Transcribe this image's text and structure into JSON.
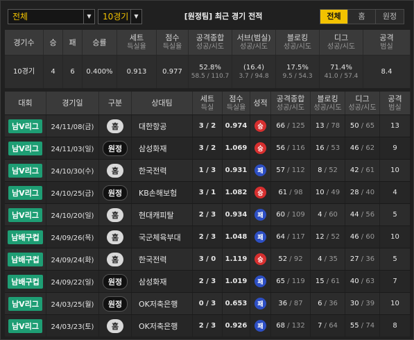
{
  "controls": {
    "filter_value": "전체",
    "games_value": "10경기",
    "title": "[원정팀] 최근 경기 전적",
    "segments": [
      {
        "label": "전체",
        "active": true
      },
      {
        "label": "홈",
        "active": false
      },
      {
        "label": "원정",
        "active": false
      }
    ]
  },
  "summary": {
    "headers": [
      {
        "main": "경기수",
        "sub": ""
      },
      {
        "main": "승",
        "sub": ""
      },
      {
        "main": "패",
        "sub": ""
      },
      {
        "main": "승률",
        "sub": ""
      },
      {
        "main": "세트",
        "sub": "득실율"
      },
      {
        "main": "점수",
        "sub": "득실율"
      },
      {
        "main": "공격종합",
        "sub": "성공/시도"
      },
      {
        "main": "서브(범실)",
        "sub": "성공/시도"
      },
      {
        "main": "블로킹",
        "sub": "성공/시도"
      },
      {
        "main": "디그",
        "sub": "성공/시도"
      },
      {
        "main": "공격",
        "sub": "범실"
      }
    ],
    "values": [
      {
        "main": "10경기",
        "sub": ""
      },
      {
        "main": "4",
        "sub": ""
      },
      {
        "main": "6",
        "sub": ""
      },
      {
        "main": "0.400%",
        "sub": ""
      },
      {
        "main": "0.913",
        "sub": ""
      },
      {
        "main": "0.977",
        "sub": ""
      },
      {
        "main": "52.8%",
        "sub": "58.5 / 110.7"
      },
      {
        "main": "(16.4)",
        "sub": "3.7 / 94.8"
      },
      {
        "main": "17.5%",
        "sub": "9.5 / 54.3"
      },
      {
        "main": "71.4%",
        "sub": "41.0 / 57.4"
      },
      {
        "main": "8.4",
        "sub": ""
      }
    ]
  },
  "table": {
    "headers": [
      {
        "main": "대회",
        "sub": ""
      },
      {
        "main": "경기일",
        "sub": ""
      },
      {
        "main": "구분",
        "sub": ""
      },
      {
        "main": "상대팀",
        "sub": ""
      },
      {
        "main": "세트",
        "sub": "득실"
      },
      {
        "main": "점수",
        "sub": "득실율"
      },
      {
        "main": "성적",
        "sub": ""
      },
      {
        "main": "공격종합",
        "sub": "성공/시도"
      },
      {
        "main": "블로킹",
        "sub": "성공/시도"
      },
      {
        "main": "디그",
        "sub": "성공/시도"
      },
      {
        "main": "공격",
        "sub": "범실"
      }
    ],
    "rows": [
      {
        "league": "남V리그",
        "date": "24/11/08(금)",
        "venue": "홈",
        "venue_type": "home",
        "opponent": "대한항공",
        "sets": "3 / 2",
        "pts": "0.974",
        "result": "승",
        "result_type": "win",
        "atk_a": "66",
        "atk_b": "125",
        "blk_a": "13",
        "blk_b": "78",
        "dig_a": "50",
        "dig_b": "65",
        "err": "13"
      },
      {
        "league": "남V리그",
        "date": "24/11/03(일)",
        "venue": "원정",
        "venue_type": "away",
        "opponent": "삼성화재",
        "sets": "3 / 2",
        "pts": "1.069",
        "result": "승",
        "result_type": "win",
        "atk_a": "56",
        "atk_b": "116",
        "blk_a": "16",
        "blk_b": "53",
        "dig_a": "46",
        "dig_b": "62",
        "err": "9"
      },
      {
        "league": "남V리그",
        "date": "24/10/30(수)",
        "venue": "홈",
        "venue_type": "home",
        "opponent": "한국전력",
        "sets": "1 / 3",
        "pts": "0.931",
        "result": "패",
        "result_type": "loss",
        "atk_a": "57",
        "atk_b": "112",
        "blk_a": "8",
        "blk_b": "52",
        "dig_a": "42",
        "dig_b": "61",
        "err": "10"
      },
      {
        "league": "남V리그",
        "date": "24/10/25(금)",
        "venue": "원정",
        "venue_type": "away",
        "opponent": "KB손해보험",
        "sets": "3 / 1",
        "pts": "1.082",
        "result": "승",
        "result_type": "win",
        "atk_a": "61",
        "atk_b": "98",
        "blk_a": "10",
        "blk_b": "49",
        "dig_a": "28",
        "dig_b": "40",
        "err": "4"
      },
      {
        "league": "남V리그",
        "date": "24/10/20(일)",
        "venue": "홈",
        "venue_type": "home",
        "opponent": "현대캐피탈",
        "sets": "2 / 3",
        "pts": "0.934",
        "result": "패",
        "result_type": "loss",
        "atk_a": "60",
        "atk_b": "109",
        "blk_a": "4",
        "blk_b": "60",
        "dig_a": "44",
        "dig_b": "56",
        "err": "5"
      },
      {
        "league": "남배구컵",
        "date": "24/09/26(목)",
        "venue": "홈",
        "venue_type": "home",
        "opponent": "국군체육부대",
        "sets": "2 / 3",
        "pts": "1.048",
        "result": "패",
        "result_type": "loss",
        "atk_a": "64",
        "atk_b": "117",
        "blk_a": "12",
        "blk_b": "52",
        "dig_a": "46",
        "dig_b": "60",
        "err": "10"
      },
      {
        "league": "남배구컵",
        "date": "24/09/24(화)",
        "venue": "홈",
        "venue_type": "home",
        "opponent": "한국전력",
        "sets": "3 / 0",
        "pts": "1.119",
        "result": "승",
        "result_type": "win",
        "atk_a": "52",
        "atk_b": "92",
        "blk_a": "4",
        "blk_b": "35",
        "dig_a": "27",
        "dig_b": "36",
        "err": "5"
      },
      {
        "league": "남배구컵",
        "date": "24/09/22(일)",
        "venue": "원정",
        "venue_type": "away",
        "opponent": "삼성화재",
        "sets": "2 / 3",
        "pts": "1.019",
        "result": "패",
        "result_type": "loss",
        "atk_a": "65",
        "atk_b": "119",
        "blk_a": "15",
        "blk_b": "61",
        "dig_a": "40",
        "dig_b": "63",
        "err": "7"
      },
      {
        "league": "남V리그",
        "date": "24/03/25(월)",
        "venue": "원정",
        "venue_type": "away",
        "opponent": "OK저축은행",
        "sets": "0 / 3",
        "pts": "0.653",
        "result": "패",
        "result_type": "loss",
        "atk_a": "36",
        "atk_b": "87",
        "blk_a": "6",
        "blk_b": "36",
        "dig_a": "30",
        "dig_b": "39",
        "err": "10"
      },
      {
        "league": "남V리그",
        "date": "24/03/23(토)",
        "venue": "홈",
        "venue_type": "home",
        "opponent": "OK저축은행",
        "sets": "2 / 3",
        "pts": "0.926",
        "result": "패",
        "result_type": "loss",
        "atk_a": "68",
        "atk_b": "132",
        "blk_a": "7",
        "blk_b": "64",
        "dig_a": "55",
        "dig_b": "74",
        "err": "8"
      }
    ]
  }
}
